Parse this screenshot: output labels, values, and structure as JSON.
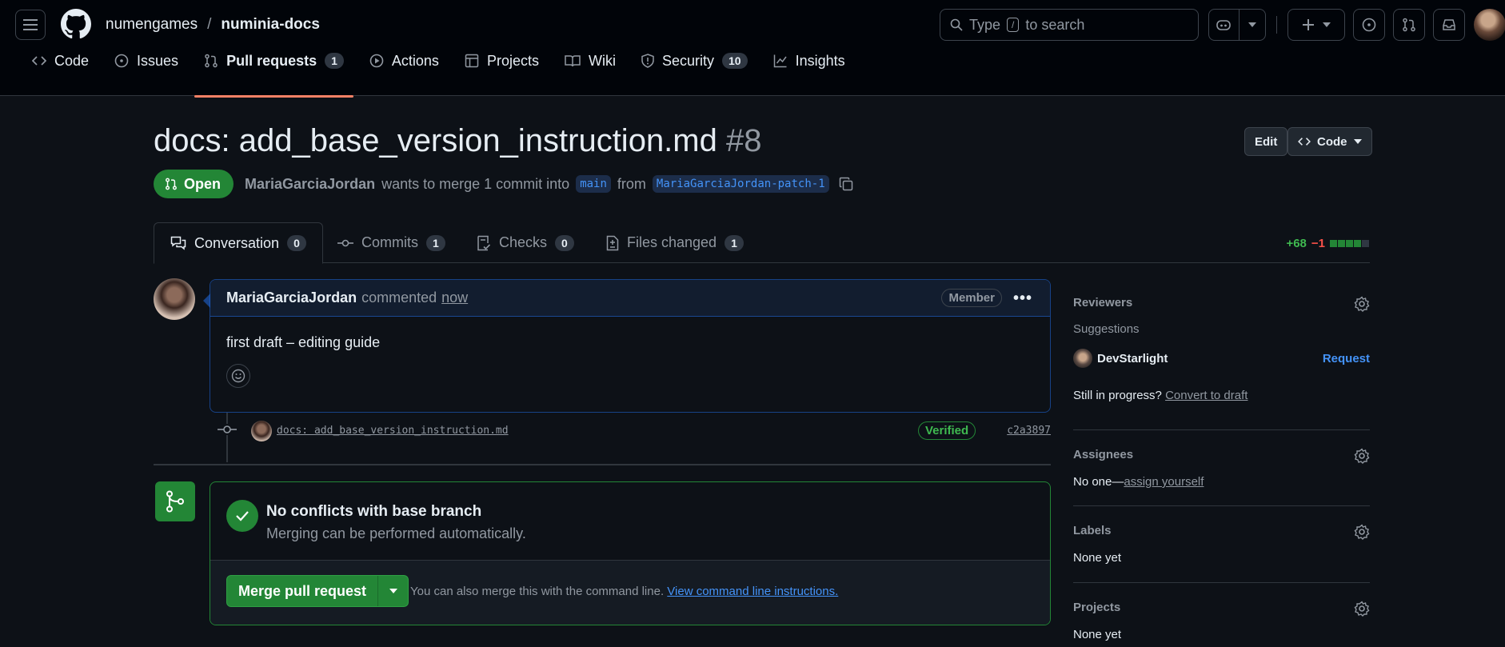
{
  "header": {
    "owner": "numengames",
    "separator": "/",
    "repo": "numinia-docs",
    "search_prefix": "Type",
    "search_key": "/",
    "search_suffix": "to search"
  },
  "repo_tabs": [
    {
      "label": "Code",
      "icon": "code-icon"
    },
    {
      "label": "Issues",
      "icon": "issue-icon"
    },
    {
      "label": "Pull requests",
      "icon": "pull-request-icon",
      "count": "1",
      "selected": true
    },
    {
      "label": "Actions",
      "icon": "play-icon"
    },
    {
      "label": "Projects",
      "icon": "table-icon"
    },
    {
      "label": "Wiki",
      "icon": "book-icon"
    },
    {
      "label": "Security",
      "icon": "shield-icon",
      "count": "10"
    },
    {
      "label": "Insights",
      "icon": "graph-icon"
    }
  ],
  "pr": {
    "title": "docs: add_base_version_instruction.md",
    "number": "#8",
    "edit_label": "Edit",
    "code_label": "Code",
    "state": "Open",
    "author": "MariaGarciaJordan",
    "merge_text": "wants to merge 1 commit into",
    "base_branch": "main",
    "from_text": "from",
    "head_branch": "MariaGarciaJordan-patch-1"
  },
  "pr_tabs": [
    {
      "label": "Conversation",
      "count": "0",
      "selected": true
    },
    {
      "label": "Commits",
      "count": "1"
    },
    {
      "label": "Checks",
      "count": "0"
    },
    {
      "label": "Files changed",
      "count": "1"
    }
  ],
  "diffstat": {
    "additions": "+68",
    "deletions": "−1"
  },
  "comment": {
    "author": "MariaGarciaJordan",
    "action": "commented",
    "time": "now",
    "badge": "Member",
    "body": "first draft – editing guide"
  },
  "commit": {
    "message": "docs: add_base_version_instruction.md",
    "verified": "Verified",
    "sha": "c2a3897"
  },
  "merge": {
    "title": "No conflicts with base branch",
    "subtitle": "Merging can be performed automatically.",
    "button": "Merge pull request",
    "hint": "You can also merge this with the command line.",
    "hint_link": "View command line instructions."
  },
  "sidebar": {
    "reviewers": {
      "title": "Reviewers",
      "suggestions": "Suggestions",
      "suggested_user": "DevStarlight",
      "request": "Request",
      "still_text": "Still in progress?",
      "convert": "Convert to draft"
    },
    "assignees": {
      "title": "Assignees",
      "value": "No one—",
      "link": "assign yourself"
    },
    "labels": {
      "title": "Labels",
      "value": "None yet"
    },
    "projects": {
      "title": "Projects",
      "value": "None yet"
    }
  },
  "colors": {
    "accent_green": "#238636",
    "link_blue": "#4493f8",
    "tab_underline": "#f78166"
  }
}
